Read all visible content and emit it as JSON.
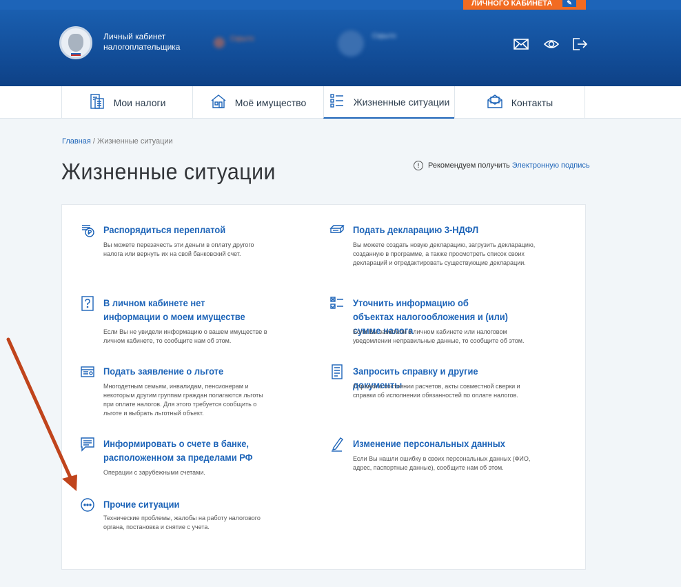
{
  "top_strip": {
    "orange_tab_label": "ЛИЧНОГО КАБИНЕТА",
    "edit_icon": "pencil-icon"
  },
  "header": {
    "brand_line1": "Личный кабинет",
    "brand_line2": "налогоплательщика",
    "blurred_notice": "Скрыто",
    "blurred_user": "Скрыто",
    "icons": [
      "mail-icon",
      "eye-icon",
      "logout-icon"
    ]
  },
  "nav": [
    {
      "label": "Мои налоги",
      "icon": "tax-document-icon"
    },
    {
      "label": "Моё имущество",
      "icon": "house-icon"
    },
    {
      "label": "Жизненные ситуации",
      "icon": "list-icon",
      "active": true
    },
    {
      "label": "Контакты",
      "icon": "envelope-icon"
    }
  ],
  "breadcrumb": {
    "home": "Главная",
    "separator": " / ",
    "current": "Жизненные ситуации"
  },
  "page_title": "Жизненные ситуации",
  "recommend": {
    "text": "Рекомендуем получить ",
    "link": "Электронную подпись",
    "icon": "info-icon"
  },
  "items": [
    {
      "title": "Распорядиться переплатой",
      "desc": "Вы можете перезачесть эти деньги в оплату другого налога или вернуть их на свой банковский счет.",
      "icon": "ruble-coin-icon"
    },
    {
      "title": "Подать декларацию 3-НДФЛ",
      "desc": "Вы можете создать новую декларацию, загрузить декларацию, созданную в программе, а также просмотреть список своих деклараций и отредактировать существующие декларации.",
      "icon": "declaration-icon"
    },
    {
      "title": "В личном кабинете нет информации о моем имуществе",
      "desc": "Если Вы не увидели информацию о вашем имуществе в личном кабинете, то сообщите нам об этом.",
      "icon": "question-icon"
    },
    {
      "title": "Уточнить информацию об объектах налогообложения и (или) сумме налога",
      "desc": "Если Вы заметили в личном кабинете или налоговом уведомлении неправильные данные, то сообщите об этом.",
      "icon": "checklist-icon"
    },
    {
      "title": "Подать заявление о льготе",
      "desc": "Многодетным семьям, инвалидам, пенсионерам и некоторым другим группам граждан полагаются льготы при оплате налогов. Для этого требуется сообщить о льготе и выбрать льготный объект.",
      "icon": "application-icon"
    },
    {
      "title": "Запросить справку и другие документы",
      "desc": "Справки о состоянии расчетов, акты совместной сверки и справки об исполнении обязанностей по оплате налогов.",
      "icon": "document-icon"
    },
    {
      "title": "Информировать о счете в банке, расположенном за пределами РФ",
      "desc": "Операции с зарубежными счетами.",
      "icon": "message-icon"
    },
    {
      "title": "Изменение персональных данных",
      "desc": "Если Вы нашли ошибку в своих персональных данных (ФИО, адрес, паспортные данные), сообщите нам об этом.",
      "icon": "pen-icon"
    },
    {
      "title": "Прочие ситуации",
      "desc": "Технические проблемы, жалобы на работу налогового органа, постановка и снятие с учета.",
      "icon": "more-icon"
    }
  ],
  "colors": {
    "accent": "#1d64b8",
    "orange": "#f26b21",
    "annotation": "#c0441c"
  }
}
